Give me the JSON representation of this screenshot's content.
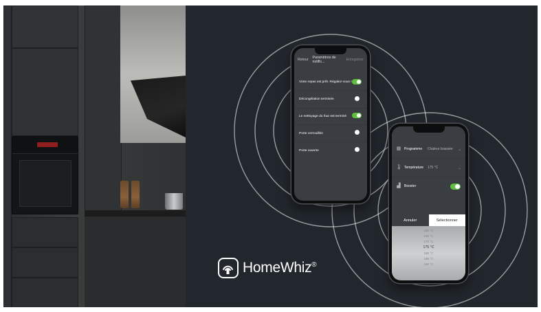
{
  "brand": {
    "name": "HomeWhiz",
    "registered": "®"
  },
  "phone_notifications": {
    "nav": {
      "back": "Retour",
      "title": "Paramètres de notific...",
      "save": "Enregistrer"
    },
    "items": [
      {
        "label": "Votre repas est prêt. Régalez-vous !",
        "enabled": true
      },
      {
        "label": "Décongélation terminée",
        "enabled": false
      },
      {
        "label": "Le nettoyage du four est terminé",
        "enabled": true
      },
      {
        "label": "Porte verrouillée",
        "enabled": false
      },
      {
        "label": "Porte ouverte",
        "enabled": false
      }
    ]
  },
  "phone_oven": {
    "settings": [
      {
        "label": "Programme",
        "value": "Chaleur brassée",
        "icon": "program-icon"
      },
      {
        "label": "Température",
        "value": "175 °C",
        "icon": "thermometer-icon"
      },
      {
        "label": "Booster",
        "value": "",
        "icon": "booster-icon",
        "enabled": true
      }
    ],
    "picker_cancel": "Annuler",
    "picker_select": "Sélectionner",
    "picker_values": [
      "160 °C",
      "165 °C",
      "170 °C",
      "175 °C",
      "180 °C",
      "185 °C",
      "190 °C"
    ],
    "picker_selected_index": 3
  },
  "colors": {
    "toggle_on": "#5fbf3f",
    "background": "#22272d"
  }
}
